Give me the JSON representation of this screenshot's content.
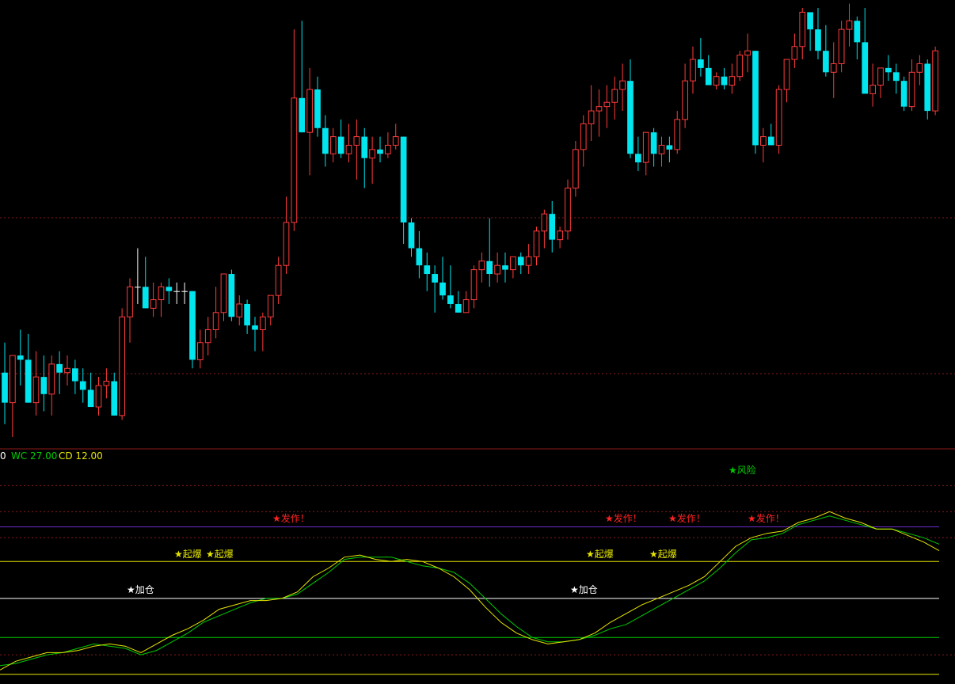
{
  "indicator_header": {
    "prefix": "0",
    "wc_label": "WC 27.00",
    "cd_label": "CD 12.00"
  },
  "colors": {
    "up": "#ff3b3b",
    "down": "#00e5ee",
    "wc_line": "#00cc00",
    "cd_line": "#e6e600",
    "grid": "#8b1a1a"
  },
  "chart_data": [
    {
      "type": "candlestick",
      "ylim": [
        0,
        100
      ],
      "candles": [
        {
          "o": 15,
          "h": 22,
          "l": 3,
          "c": 8
        },
        {
          "o": 8,
          "h": 18,
          "l": 0,
          "c": 19
        },
        {
          "o": 19,
          "h": 25,
          "l": 12,
          "c": 18
        },
        {
          "o": 18,
          "h": 24,
          "l": 8,
          "c": 8
        },
        {
          "o": 8,
          "h": 20,
          "l": 5,
          "c": 14
        },
        {
          "o": 14,
          "h": 19,
          "l": 6,
          "c": 10
        },
        {
          "o": 10,
          "h": 19,
          "l": 5,
          "c": 17
        },
        {
          "o": 17,
          "h": 20,
          "l": 10,
          "c": 15
        },
        {
          "o": 15,
          "h": 19,
          "l": 12,
          "c": 16
        },
        {
          "o": 16,
          "h": 18,
          "l": 10,
          "c": 13
        },
        {
          "o": 13,
          "h": 16,
          "l": 8,
          "c": 11
        },
        {
          "o": 11,
          "h": 15,
          "l": 7,
          "c": 7
        },
        {
          "o": 7,
          "h": 14,
          "l": 5,
          "c": 12
        },
        {
          "o": 12,
          "h": 16,
          "l": 9,
          "c": 13
        },
        {
          "o": 13,
          "h": 15,
          "l": 5,
          "c": 5
        },
        {
          "o": 5,
          "h": 30,
          "l": 4,
          "c": 28
        },
        {
          "o": 28,
          "h": 37,
          "l": 22,
          "c": 35
        },
        {
          "o": 35,
          "h": 44,
          "l": 31,
          "c": 35
        },
        {
          "o": 35,
          "h": 42,
          "l": 30,
          "c": 30
        },
        {
          "o": 30,
          "h": 36,
          "l": 28,
          "c": 32
        },
        {
          "o": 32,
          "h": 36,
          "l": 28,
          "c": 35
        },
        {
          "o": 35,
          "h": 37,
          "l": 31,
          "c": 34
        },
        {
          "o": 34,
          "h": 36,
          "l": 31,
          "c": 34
        },
        {
          "o": 34,
          "h": 36,
          "l": 31,
          "c": 34
        },
        {
          "o": 34,
          "h": 34,
          "l": 16,
          "c": 18
        },
        {
          "o": 18,
          "h": 25,
          "l": 16,
          "c": 22
        },
        {
          "o": 22,
          "h": 28,
          "l": 19,
          "c": 25
        },
        {
          "o": 25,
          "h": 35,
          "l": 23,
          "c": 29
        },
        {
          "o": 29,
          "h": 38,
          "l": 27,
          "c": 38
        },
        {
          "o": 38,
          "h": 39,
          "l": 27,
          "c": 28
        },
        {
          "o": 28,
          "h": 33,
          "l": 26,
          "c": 31
        },
        {
          "o": 31,
          "h": 32,
          "l": 24,
          "c": 26
        },
        {
          "o": 26,
          "h": 28,
          "l": 20,
          "c": 25
        },
        {
          "o": 25,
          "h": 29,
          "l": 20,
          "c": 28
        },
        {
          "o": 28,
          "h": 32,
          "l": 26,
          "c": 33
        },
        {
          "o": 33,
          "h": 42,
          "l": 31,
          "c": 40
        },
        {
          "o": 40,
          "h": 56,
          "l": 38,
          "c": 50
        },
        {
          "o": 50,
          "h": 95,
          "l": 48,
          "c": 79
        },
        {
          "o": 79,
          "h": 97,
          "l": 71,
          "c": 71
        },
        {
          "o": 71,
          "h": 86,
          "l": 61,
          "c": 81
        },
        {
          "o": 81,
          "h": 84,
          "l": 70,
          "c": 72
        },
        {
          "o": 72,
          "h": 75,
          "l": 63,
          "c": 66
        },
        {
          "o": 66,
          "h": 72,
          "l": 64,
          "c": 70
        },
        {
          "o": 70,
          "h": 74,
          "l": 65,
          "c": 66
        },
        {
          "o": 66,
          "h": 73,
          "l": 64,
          "c": 68
        },
        {
          "o": 68,
          "h": 74,
          "l": 60,
          "c": 70
        },
        {
          "o": 70,
          "h": 72,
          "l": 58,
          "c": 65
        },
        {
          "o": 65,
          "h": 70,
          "l": 59,
          "c": 67
        },
        {
          "o": 67,
          "h": 70,
          "l": 64,
          "c": 66
        },
        {
          "o": 66,
          "h": 71,
          "l": 65,
          "c": 68
        },
        {
          "o": 68,
          "h": 73,
          "l": 67,
          "c": 70
        },
        {
          "o": 70,
          "h": 70,
          "l": 45,
          "c": 50
        },
        {
          "o": 50,
          "h": 51,
          "l": 42,
          "c": 44
        },
        {
          "o": 44,
          "h": 48,
          "l": 37,
          "c": 40
        },
        {
          "o": 40,
          "h": 43,
          "l": 34,
          "c": 38
        },
        {
          "o": 38,
          "h": 40,
          "l": 29,
          "c": 36
        },
        {
          "o": 36,
          "h": 42,
          "l": 32,
          "c": 33
        },
        {
          "o": 33,
          "h": 40,
          "l": 30,
          "c": 31
        },
        {
          "o": 31,
          "h": 34,
          "l": 29,
          "c": 29
        },
        {
          "o": 29,
          "h": 34,
          "l": 29,
          "c": 32
        },
        {
          "o": 32,
          "h": 40,
          "l": 30,
          "c": 39
        },
        {
          "o": 39,
          "h": 43,
          "l": 36,
          "c": 41
        },
        {
          "o": 41,
          "h": 51,
          "l": 35,
          "c": 38
        },
        {
          "o": 38,
          "h": 43,
          "l": 36,
          "c": 40
        },
        {
          "o": 40,
          "h": 43,
          "l": 36,
          "c": 39
        },
        {
          "o": 39,
          "h": 42,
          "l": 37,
          "c": 42
        },
        {
          "o": 42,
          "h": 43,
          "l": 38,
          "c": 40
        },
        {
          "o": 40,
          "h": 45,
          "l": 38,
          "c": 42
        },
        {
          "o": 42,
          "h": 49,
          "l": 40,
          "c": 48
        },
        {
          "o": 48,
          "h": 53,
          "l": 44,
          "c": 52
        },
        {
          "o": 52,
          "h": 55,
          "l": 43,
          "c": 46
        },
        {
          "o": 46,
          "h": 49,
          "l": 44,
          "c": 48
        },
        {
          "o": 48,
          "h": 60,
          "l": 46,
          "c": 58
        },
        {
          "o": 58,
          "h": 69,
          "l": 56,
          "c": 67
        },
        {
          "o": 67,
          "h": 75,
          "l": 63,
          "c": 73
        },
        {
          "o": 73,
          "h": 82,
          "l": 69,
          "c": 76
        },
        {
          "o": 76,
          "h": 81,
          "l": 70,
          "c": 77
        },
        {
          "o": 77,
          "h": 82,
          "l": 72,
          "c": 78
        },
        {
          "o": 78,
          "h": 84,
          "l": 74,
          "c": 81
        },
        {
          "o": 81,
          "h": 87,
          "l": 76,
          "c": 83
        },
        {
          "o": 83,
          "h": 88,
          "l": 65,
          "c": 66
        },
        {
          "o": 66,
          "h": 70,
          "l": 62,
          "c": 64
        },
        {
          "o": 64,
          "h": 71,
          "l": 61,
          "c": 71
        },
        {
          "o": 71,
          "h": 72,
          "l": 63,
          "c": 66
        },
        {
          "o": 66,
          "h": 70,
          "l": 63,
          "c": 68
        },
        {
          "o": 68,
          "h": 70,
          "l": 64,
          "c": 67
        },
        {
          "o": 67,
          "h": 76,
          "l": 66,
          "c": 74
        },
        {
          "o": 74,
          "h": 87,
          "l": 72,
          "c": 83
        },
        {
          "o": 83,
          "h": 91,
          "l": 80,
          "c": 88
        },
        {
          "o": 88,
          "h": 93,
          "l": 84,
          "c": 86
        },
        {
          "o": 86,
          "h": 89,
          "l": 82,
          "c": 82
        },
        {
          "o": 82,
          "h": 85,
          "l": 81,
          "c": 84
        },
        {
          "o": 84,
          "h": 86,
          "l": 81,
          "c": 82
        },
        {
          "o": 82,
          "h": 87,
          "l": 80,
          "c": 84
        },
        {
          "o": 84,
          "h": 90,
          "l": 83,
          "c": 89
        },
        {
          "o": 89,
          "h": 94,
          "l": 85,
          "c": 90
        },
        {
          "o": 90,
          "h": 90,
          "l": 66,
          "c": 68
        },
        {
          "o": 68,
          "h": 72,
          "l": 64,
          "c": 70
        },
        {
          "o": 70,
          "h": 73,
          "l": 68,
          "c": 68
        },
        {
          "o": 68,
          "h": 82,
          "l": 66,
          "c": 81
        },
        {
          "o": 81,
          "h": 88,
          "l": 78,
          "c": 88
        },
        {
          "o": 88,
          "h": 94,
          "l": 86,
          "c": 91
        },
        {
          "o": 91,
          "h": 100,
          "l": 88,
          "c": 99
        },
        {
          "o": 99,
          "h": 97,
          "l": 90,
          "c": 95
        },
        {
          "o": 95,
          "h": 100,
          "l": 88,
          "c": 90
        },
        {
          "o": 90,
          "h": 96,
          "l": 84,
          "c": 85
        },
        {
          "o": 85,
          "h": 92,
          "l": 79,
          "c": 87
        },
        {
          "o": 87,
          "h": 97,
          "l": 85,
          "c": 95
        },
        {
          "o": 95,
          "h": 101,
          "l": 91,
          "c": 97
        },
        {
          "o": 97,
          "h": 98,
          "l": 88,
          "c": 92
        },
        {
          "o": 92,
          "h": 100,
          "l": 84,
          "c": 80
        },
        {
          "o": 80,
          "h": 87,
          "l": 77,
          "c": 82
        },
        {
          "o": 82,
          "h": 85,
          "l": 79,
          "c": 86
        },
        {
          "o": 86,
          "h": 89,
          "l": 83,
          "c": 85
        },
        {
          "o": 85,
          "h": 87,
          "l": 80,
          "c": 83
        },
        {
          "o": 83,
          "h": 84,
          "l": 76,
          "c": 77
        },
        {
          "o": 77,
          "h": 88,
          "l": 76,
          "c": 85
        },
        {
          "o": 85,
          "h": 89,
          "l": 82,
          "c": 87
        },
        {
          "o": 87,
          "h": 88,
          "l": 74,
          "c": 76
        },
        {
          "o": 76,
          "h": 91,
          "l": 75,
          "c": 90
        }
      ]
    },
    {
      "type": "line",
      "ylim": [
        0,
        100
      ],
      "series": [
        {
          "name": "WC",
          "values": [
            7,
            8,
            10,
            12,
            13,
            15,
            17,
            16,
            15,
            12,
            14,
            18,
            22,
            27,
            30,
            33,
            36,
            38,
            38,
            40,
            45,
            50,
            56,
            57,
            57,
            57,
            55,
            53,
            52,
            50,
            45,
            38,
            31,
            25,
            20,
            18,
            18,
            19,
            21,
            24,
            26,
            30,
            34,
            38,
            42,
            46,
            52,
            59,
            65,
            66,
            68,
            72,
            74,
            76,
            74,
            72,
            70,
            70,
            68,
            66,
            63
          ]
        },
        {
          "name": "CD",
          "values": [
            5,
            9,
            11,
            13,
            13,
            14,
            16,
            17,
            16,
            13,
            17,
            21,
            24,
            28,
            33,
            35,
            37,
            37,
            38,
            41,
            48,
            52,
            57,
            58,
            56,
            55,
            56,
            55,
            52,
            48,
            42,
            34,
            27,
            22,
            19,
            17,
            18,
            19,
            22,
            27,
            31,
            35,
            38,
            41,
            44,
            48,
            55,
            62,
            66,
            68,
            69,
            73,
            75,
            78,
            75,
            73,
            70,
            70,
            67,
            64,
            60
          ]
        }
      ],
      "signals": [
        {
          "label": "★加仓",
          "color": "#ffffff"
        },
        {
          "label": "★起爆",
          "color": "#e6e600"
        },
        {
          "label": "★起爆",
          "color": "#e6e600"
        },
        {
          "label": "★发作！",
          "color": "#ff2222"
        },
        {
          "label": "★加仓",
          "color": "#ffffff"
        },
        {
          "label": "★起爆",
          "color": "#e6e600"
        },
        {
          "label": "★发作！",
          "color": "#ff2222"
        },
        {
          "label": "★起爆",
          "color": "#e6e600"
        },
        {
          "label": "★发作！",
          "color": "#ff2222"
        },
        {
          "label": "★风险",
          "color": "#00cc00"
        },
        {
          "label": "★发作！",
          "color": "#ff2222"
        }
      ],
      "reference_levels": [
        {
          "value": 90,
          "color": "#8b1a1a",
          "dashed": true
        },
        {
          "value": 78,
          "color": "#8b1a1a",
          "dashed": true
        },
        {
          "value": 71,
          "color": "#6a2ccf",
          "dashed": false
        },
        {
          "value": 66,
          "color": "#8b1a1a",
          "dashed": true
        },
        {
          "value": 55,
          "color": "#e6e600",
          "dashed": false
        },
        {
          "value": 38,
          "color": "#ffffff",
          "dashed": false
        },
        {
          "value": 20,
          "color": "#00cc00",
          "dashed": false
        },
        {
          "value": 12,
          "color": "#8b1a1a",
          "dashed": true
        },
        {
          "value": 3,
          "color": "#e6e600",
          "dashed": false
        }
      ]
    }
  ]
}
